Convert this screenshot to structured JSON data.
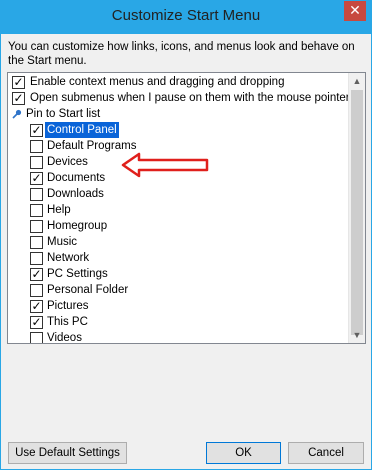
{
  "window": {
    "title": "Customize Start Menu",
    "close_label": "✕"
  },
  "description": "You can customize how links, icons, and menus look and behave on the Start menu.",
  "options": [
    {
      "label": "Enable context menus and dragging and dropping",
      "checked": true
    },
    {
      "label": "Open submenus when I pause on them with the mouse pointer",
      "checked": true
    }
  ],
  "pin_section_label": "Pin to Start list",
  "pin_items": [
    {
      "label": "Control Panel",
      "checked": true,
      "selected": true
    },
    {
      "label": "Default Programs",
      "checked": false
    },
    {
      "label": "Devices",
      "checked": false
    },
    {
      "label": "Documents",
      "checked": true
    },
    {
      "label": "Downloads",
      "checked": false
    },
    {
      "label": "Help",
      "checked": false
    },
    {
      "label": "Homegroup",
      "checked": false
    },
    {
      "label": "Music",
      "checked": false
    },
    {
      "label": "Network",
      "checked": false
    },
    {
      "label": "PC Settings",
      "checked": true
    },
    {
      "label": "Personal Folder",
      "checked": false
    },
    {
      "label": "Pictures",
      "checked": true
    },
    {
      "label": "This PC",
      "checked": true
    },
    {
      "label": "Videos",
      "checked": false
    }
  ],
  "buttons": {
    "default_settings": "Use Default Settings",
    "ok": "OK",
    "cancel": "Cancel"
  },
  "colors": {
    "title_bar": "#29a7e6",
    "selection": "#0a64d8",
    "annotation_arrow": "#e0201c"
  }
}
